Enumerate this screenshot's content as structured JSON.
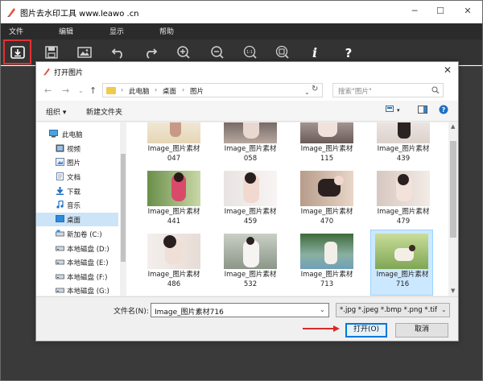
{
  "app": {
    "title": "图片去水印工具 www.leawo .cn",
    "menu": [
      "文件",
      "编辑",
      "显示",
      "帮助"
    ],
    "toolbar_icons": [
      "open-file-icon",
      "save-icon",
      "image-icon",
      "undo-icon",
      "redo-icon",
      "zoom-in-icon",
      "zoom-out-icon",
      "actual-size-icon",
      "fit-window-icon",
      "info-icon",
      "help-icon"
    ],
    "accent": "#e53030"
  },
  "dialog": {
    "title": "打开图片",
    "breadcrumb": [
      "此电脑",
      "桌面",
      "图片"
    ],
    "search_placeholder": "搜索\"图片\"",
    "organize": "组织 ▾",
    "new_folder": "新建文件夹",
    "sidebar": [
      {
        "label": "此电脑",
        "icon": "computer-icon"
      },
      {
        "label": "视频",
        "icon": "video-folder-icon"
      },
      {
        "label": "图片",
        "icon": "pictures-folder-icon"
      },
      {
        "label": "文档",
        "icon": "documents-folder-icon"
      },
      {
        "label": "下载",
        "icon": "downloads-folder-icon"
      },
      {
        "label": "音乐",
        "icon": "music-folder-icon"
      },
      {
        "label": "桌面",
        "icon": "desktop-folder-icon",
        "selected": true
      },
      {
        "label": "新加卷 (C:)",
        "icon": "drive-icon"
      },
      {
        "label": "本地磁盘 (D:)",
        "icon": "drive-icon"
      },
      {
        "label": "本地磁盘 (E:)",
        "icon": "drive-icon"
      },
      {
        "label": "本地磁盘 (F:)",
        "icon": "drive-icon"
      },
      {
        "label": "本地磁盘 (G:)",
        "icon": "drive-icon"
      }
    ],
    "files": [
      {
        "line1": "Image_图片素材",
        "line2": "047"
      },
      {
        "line1": "Image_图片素材",
        "line2": "058"
      },
      {
        "line1": "Image_图片素材",
        "line2": "115"
      },
      {
        "line1": "Image_图片素材",
        "line2": "439"
      },
      {
        "line1": "Image_图片素材",
        "line2": "441"
      },
      {
        "line1": "Image_图片素材",
        "line2": "459"
      },
      {
        "line1": "Image_图片素材",
        "line2": "470"
      },
      {
        "line1": "Image_图片素材",
        "line2": "479"
      },
      {
        "line1": "Image_图片素材",
        "line2": "486"
      },
      {
        "line1": "Image_图片素材",
        "line2": "532"
      },
      {
        "line1": "Image_图片素材",
        "line2": "713"
      },
      {
        "line1": "Image_图片素材",
        "line2": "716",
        "selected": true
      }
    ],
    "filename_label": "文件名(N):",
    "filename_value": "Image_图片素材716",
    "filetype": "*.jpg *.jpeg *.bmp *.png *.tif",
    "open_button": "打开(O)",
    "cancel_button": "取消"
  }
}
